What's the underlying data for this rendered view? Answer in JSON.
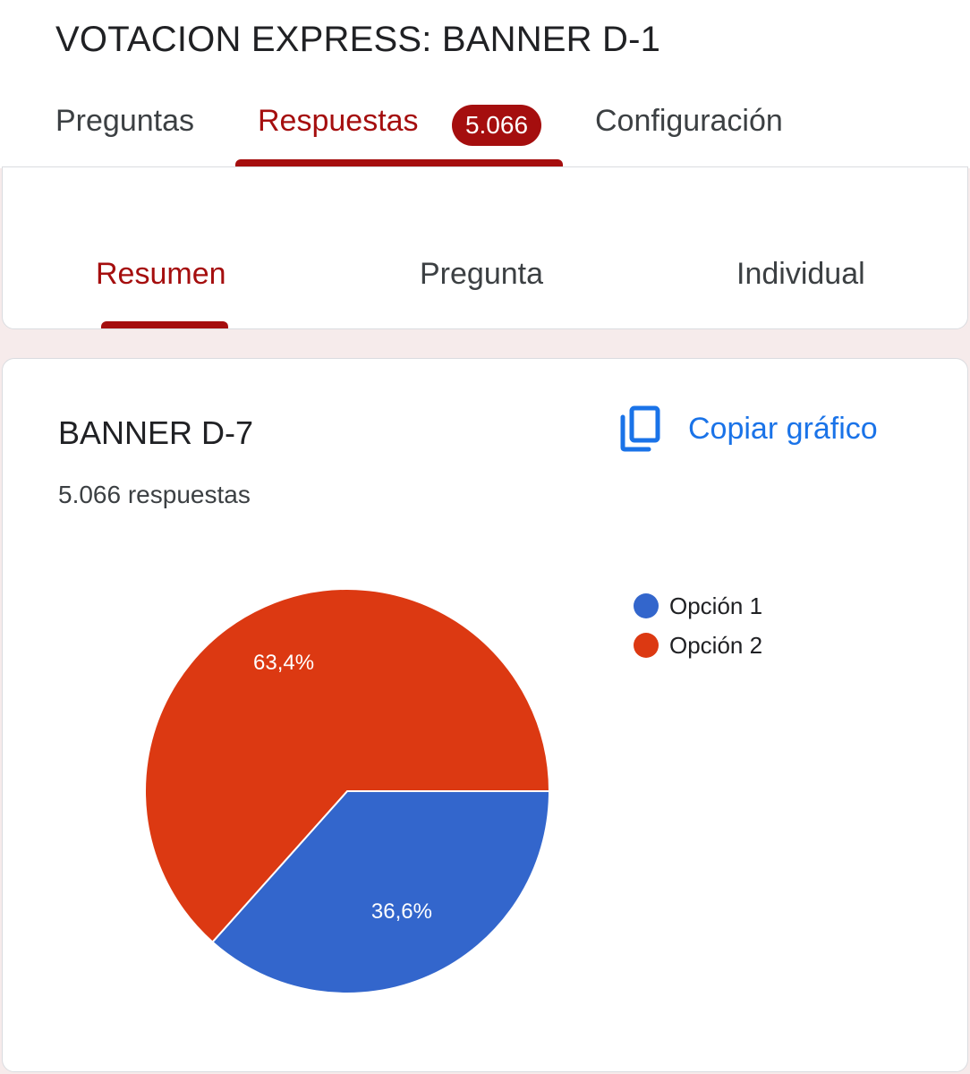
{
  "form": {
    "title": "VOTACION EXPRESS: BANNER D-1"
  },
  "top_tabs": {
    "preguntas": "Preguntas",
    "respuestas": "Respuestas",
    "respuestas_count": "5.066",
    "configuracion": "Configuración",
    "active": "Respuestas"
  },
  "sub_tabs": {
    "resumen": "Resumen",
    "pregunta": "Pregunta",
    "individual": "Individual",
    "active": "Resumen"
  },
  "question": {
    "title": "BANNER D-7",
    "response_count": "5.066 respuestas",
    "copy_label": "Copiar gráfico",
    "copy_icon": "copy-icon"
  },
  "colors": {
    "accent_red": "#a50e0e",
    "link_blue": "#1a73e8",
    "option1": "#3366cc",
    "option2": "#dc3912"
  },
  "chart_data": {
    "type": "pie",
    "categories": [
      "Opción 1",
      "Opción 2"
    ],
    "values": [
      36.6,
      63.4
    ],
    "data_labels": [
      "36,6%",
      "63,4%"
    ],
    "colors": [
      "#3366cc",
      "#dc3912"
    ],
    "legend_position": "right"
  }
}
